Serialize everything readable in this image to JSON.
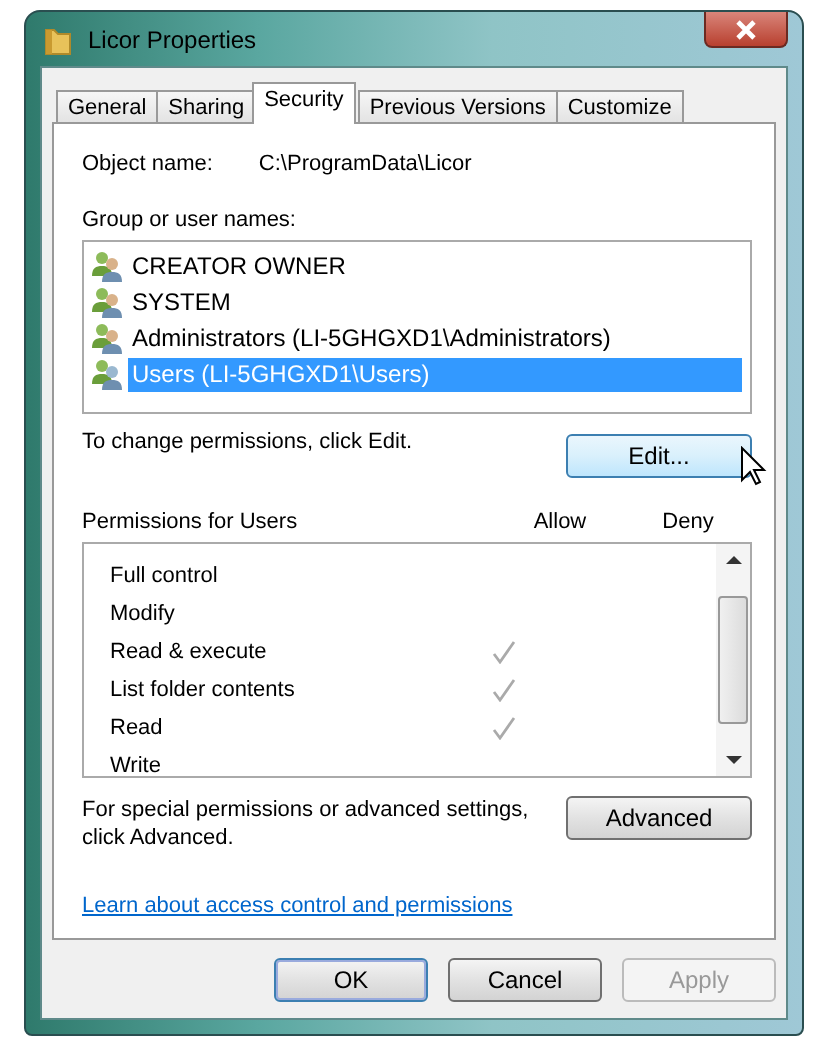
{
  "window": {
    "title": "Licor Properties"
  },
  "tabs": [
    {
      "label": "General",
      "selected": false
    },
    {
      "label": "Sharing",
      "selected": false
    },
    {
      "label": "Security",
      "selected": true
    },
    {
      "label": "Previous Versions",
      "selected": false
    },
    {
      "label": "Customize",
      "selected": false
    }
  ],
  "object_name": {
    "label": "Object name:",
    "value": "C:\\ProgramData\\Licor"
  },
  "groups": {
    "label": "Group or user names:",
    "items": [
      {
        "name": "CREATOR OWNER",
        "selected": false
      },
      {
        "name": "SYSTEM",
        "selected": false
      },
      {
        "name": "Administrators (LI-5GHGXD1\\Administrators)",
        "selected": false
      },
      {
        "name": "Users (LI-5GHGXD1\\Users)",
        "selected": true
      }
    ]
  },
  "edit_hint": "To change permissions, click Edit.",
  "edit_button": "Edit...",
  "permissions": {
    "label": "Permissions for Users",
    "allow_header": "Allow",
    "deny_header": "Deny",
    "rows": [
      {
        "name": "Full control",
        "allow": false
      },
      {
        "name": "Modify",
        "allow": false
      },
      {
        "name": "Read & execute",
        "allow": true
      },
      {
        "name": "List folder contents",
        "allow": true
      },
      {
        "name": "Read",
        "allow": true
      },
      {
        "name": "Write",
        "allow": false
      }
    ]
  },
  "advanced_hint": "For special permissions or advanced settings, click Advanced.",
  "advanced_button": "Advanced",
  "link": "Learn about access control and permissions",
  "buttons": [
    {
      "label": "OK",
      "disabled": false,
      "default": true
    },
    {
      "label": "Cancel",
      "disabled": false,
      "default": false
    },
    {
      "label": "Apply",
      "disabled": true,
      "default": false
    }
  ]
}
